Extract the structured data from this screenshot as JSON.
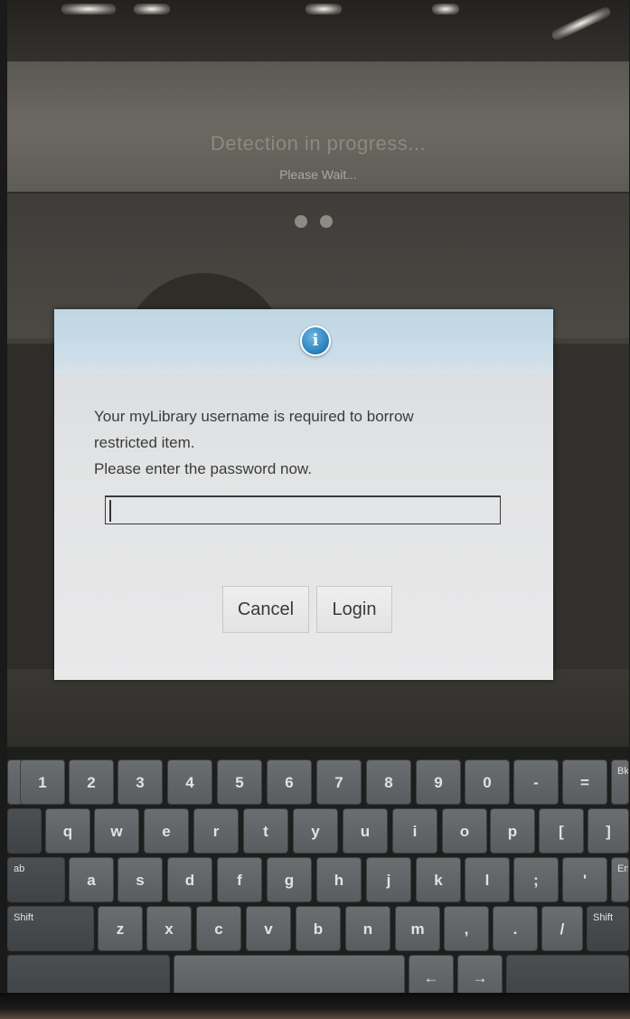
{
  "status": {
    "title": "Detection in progress...",
    "subtitle": "Please Wait..."
  },
  "dialog": {
    "icon": "info-icon",
    "message_line1": "Your myLibrary username is required to borrow",
    "message_line2": "restricted item.",
    "message_line3": "Please enter the password now.",
    "password_value": "",
    "cancel_label": "Cancel",
    "login_label": "Login"
  },
  "keyboard": {
    "row1": [
      "1",
      "2",
      "3",
      "4",
      "5",
      "6",
      "7",
      "8",
      "9",
      "0",
      "-",
      "=",
      "Bk"
    ],
    "row2": [
      "q",
      "w",
      "e",
      "r",
      "t",
      "y",
      "u",
      "i",
      "o",
      "p",
      "[",
      "]"
    ],
    "row3": [
      "a",
      "s",
      "d",
      "f",
      "g",
      "h",
      "j",
      "k",
      "l",
      ";",
      "'",
      "Enter"
    ],
    "row4": [
      "Shift",
      "z",
      "x",
      "c",
      "v",
      "b",
      "n",
      "m",
      ",",
      ".",
      "/",
      "Shift"
    ],
    "row5": [
      "←",
      "→"
    ],
    "tab_label": "ab"
  },
  "colors": {
    "dialog_header": "#cbdde8",
    "info_icon": "#2f86c0",
    "key": "#5a5d60"
  }
}
